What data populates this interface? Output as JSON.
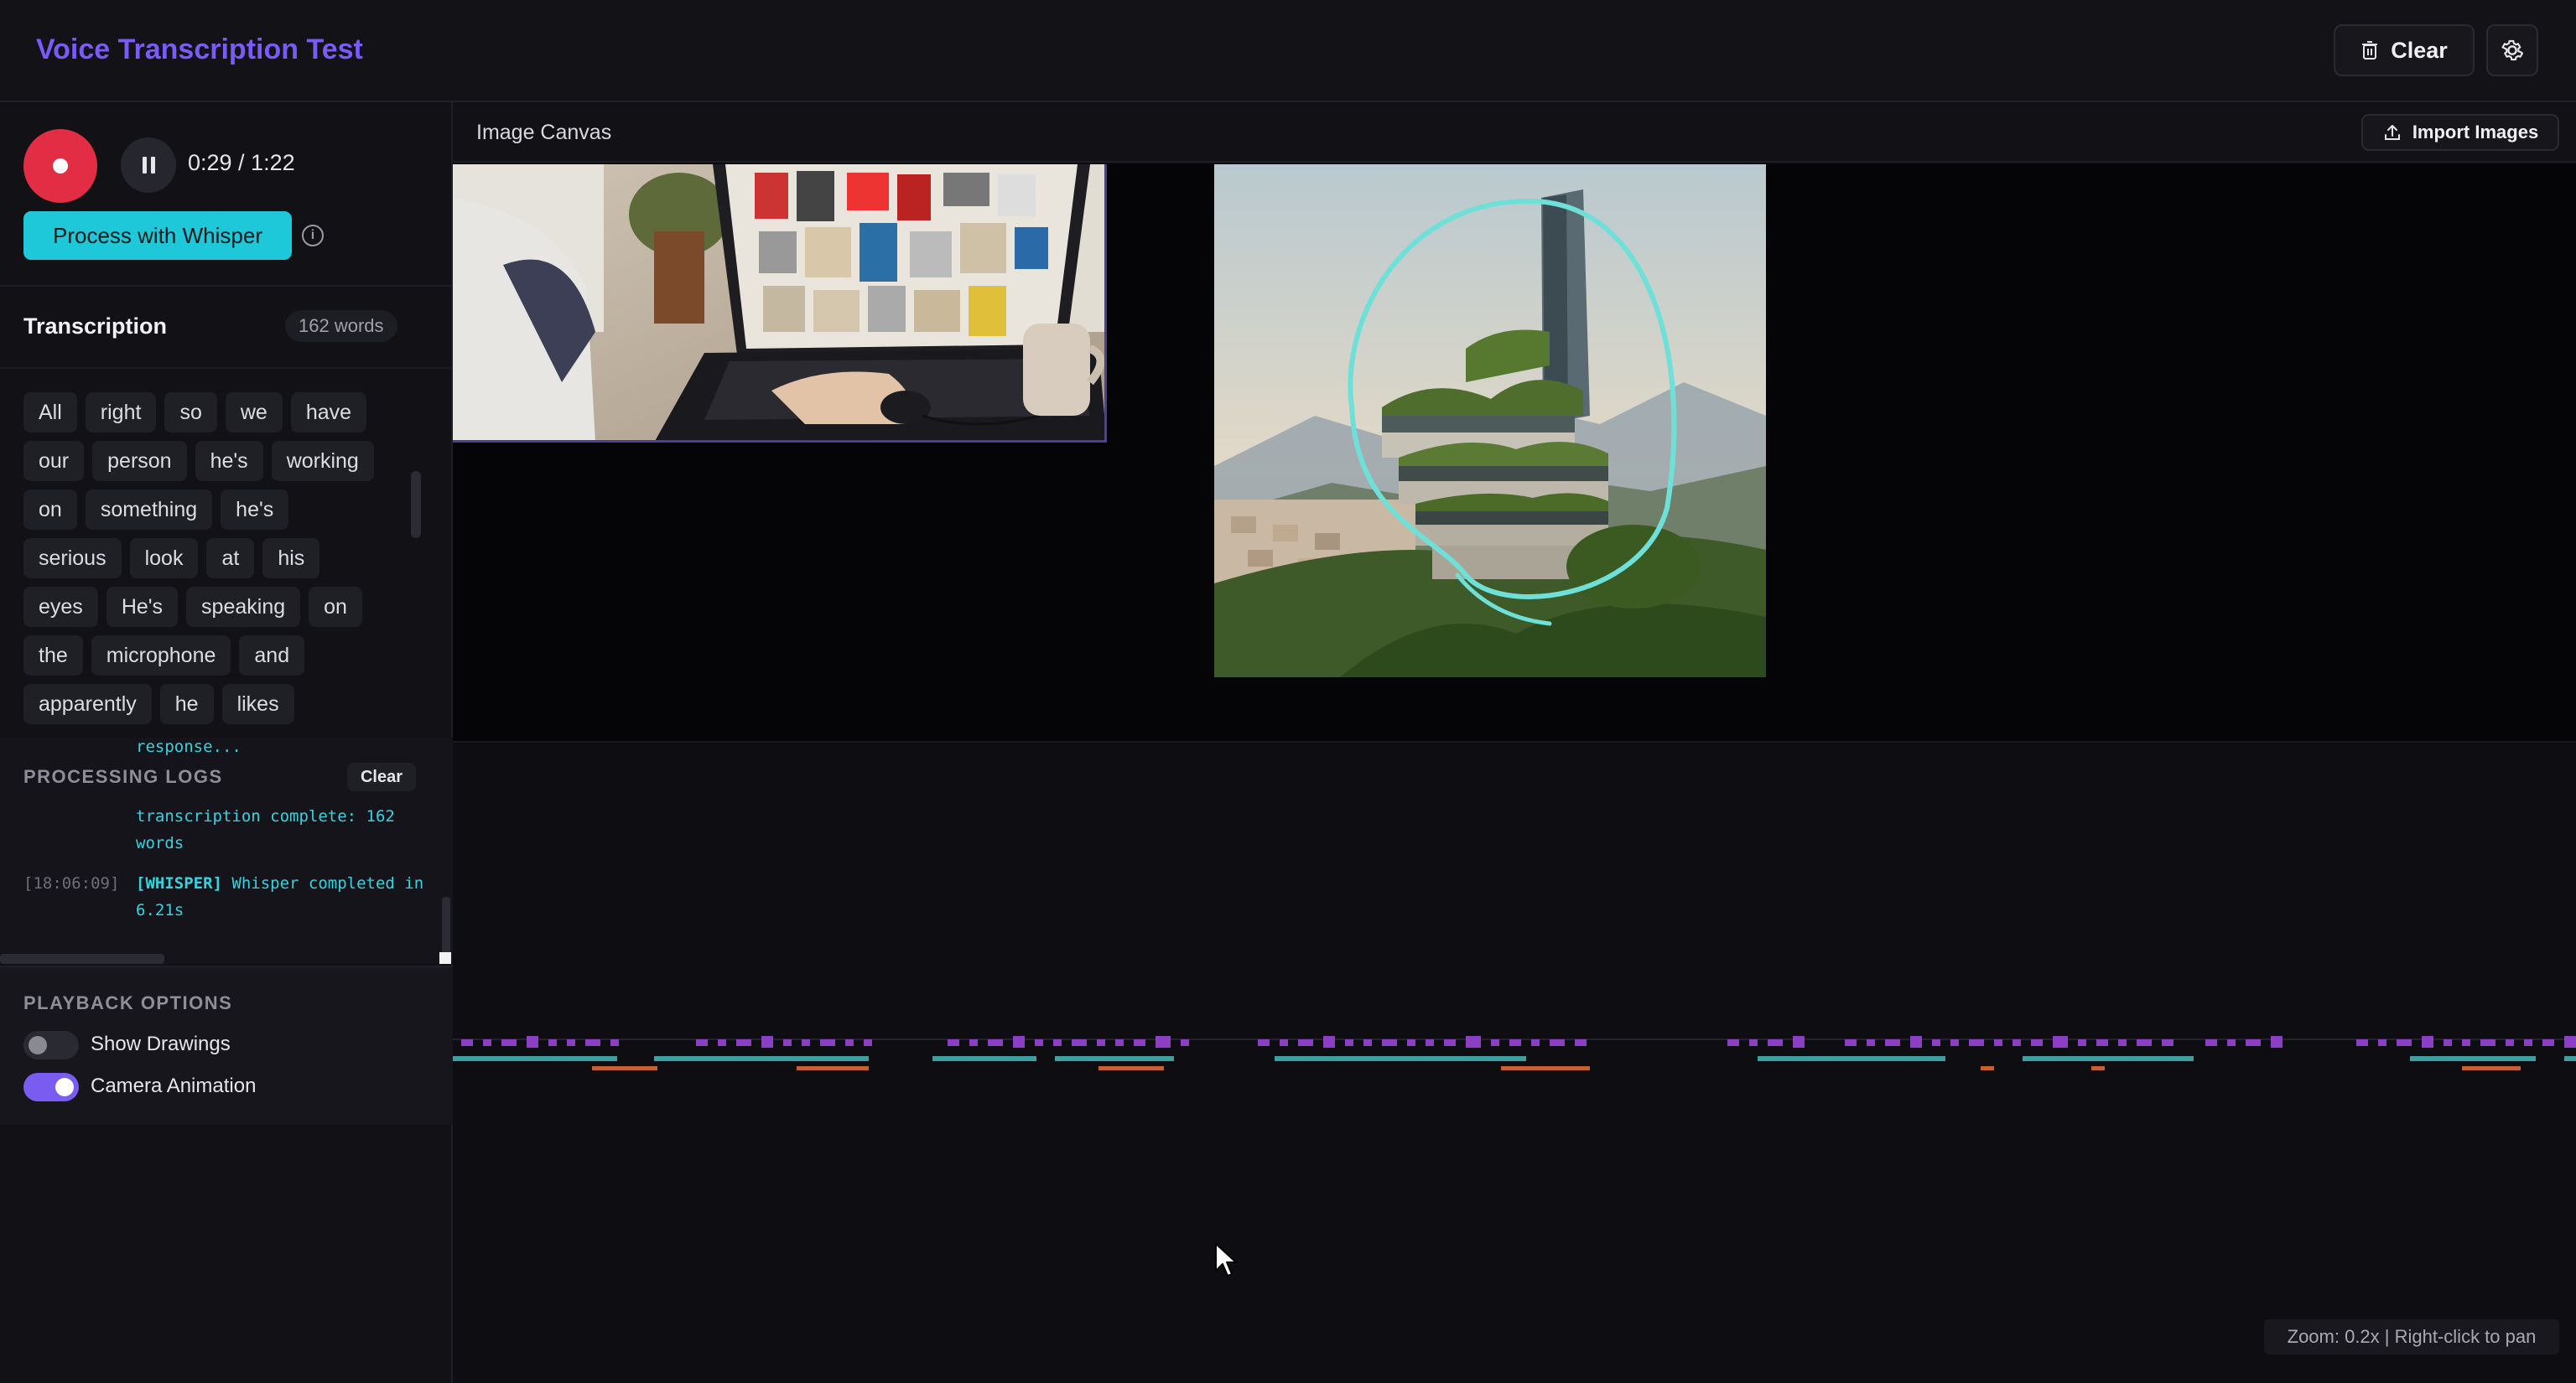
{
  "header": {
    "title": "Voice Transcription Test",
    "clear_label": "Clear",
    "icons": {
      "clear": "trash-icon",
      "settings": "gear-icon"
    }
  },
  "recorder": {
    "time": "0:29 / 1:22",
    "process_label": "Process with Whisper",
    "icons": {
      "record": "record-icon",
      "pause": "pause-icon",
      "info": "info-icon"
    }
  },
  "transcription": {
    "title": "Transcription",
    "word_count": "162 words",
    "words": [
      "All",
      "right",
      "so",
      "we",
      "have",
      "our",
      "person",
      "he's",
      "working",
      "on",
      "something",
      "he's",
      "serious",
      "look",
      "at",
      "his",
      "eyes",
      "He's",
      "speaking",
      "on",
      "the",
      "microphone",
      "and",
      "apparently",
      "he",
      "likes"
    ]
  },
  "logs": {
    "title": "PROCESSING LOGS",
    "clear_label": "Clear",
    "top_fragment": "response...",
    "entries": [
      {
        "timestamp": "",
        "tag": "",
        "message": "transcription complete: 162 words"
      },
      {
        "timestamp": "[18:06:09]",
        "tag": "[WHISPER]",
        "message": "Whisper completed in 6.21s"
      }
    ]
  },
  "playback": {
    "title": "PLAYBACK OPTIONS",
    "options": [
      {
        "label": "Show Drawings",
        "enabled": false
      },
      {
        "label": "Camera Animation",
        "enabled": true
      }
    ]
  },
  "canvas": {
    "title": "Image Canvas",
    "import_label": "Import Images",
    "icons": {
      "import": "upload-icon"
    },
    "zoom_text": "Zoom: 0.2x | Right-click to pan"
  },
  "colors": {
    "accent": "#7a5af8",
    "record": "#e22d45",
    "whisper": "#1ec8d8",
    "annotation": "#6fe0d8",
    "timeline_purple": "#8a3fc4",
    "timeline_teal": "#3f9ea0",
    "timeline_orange": "#c4632f"
  }
}
